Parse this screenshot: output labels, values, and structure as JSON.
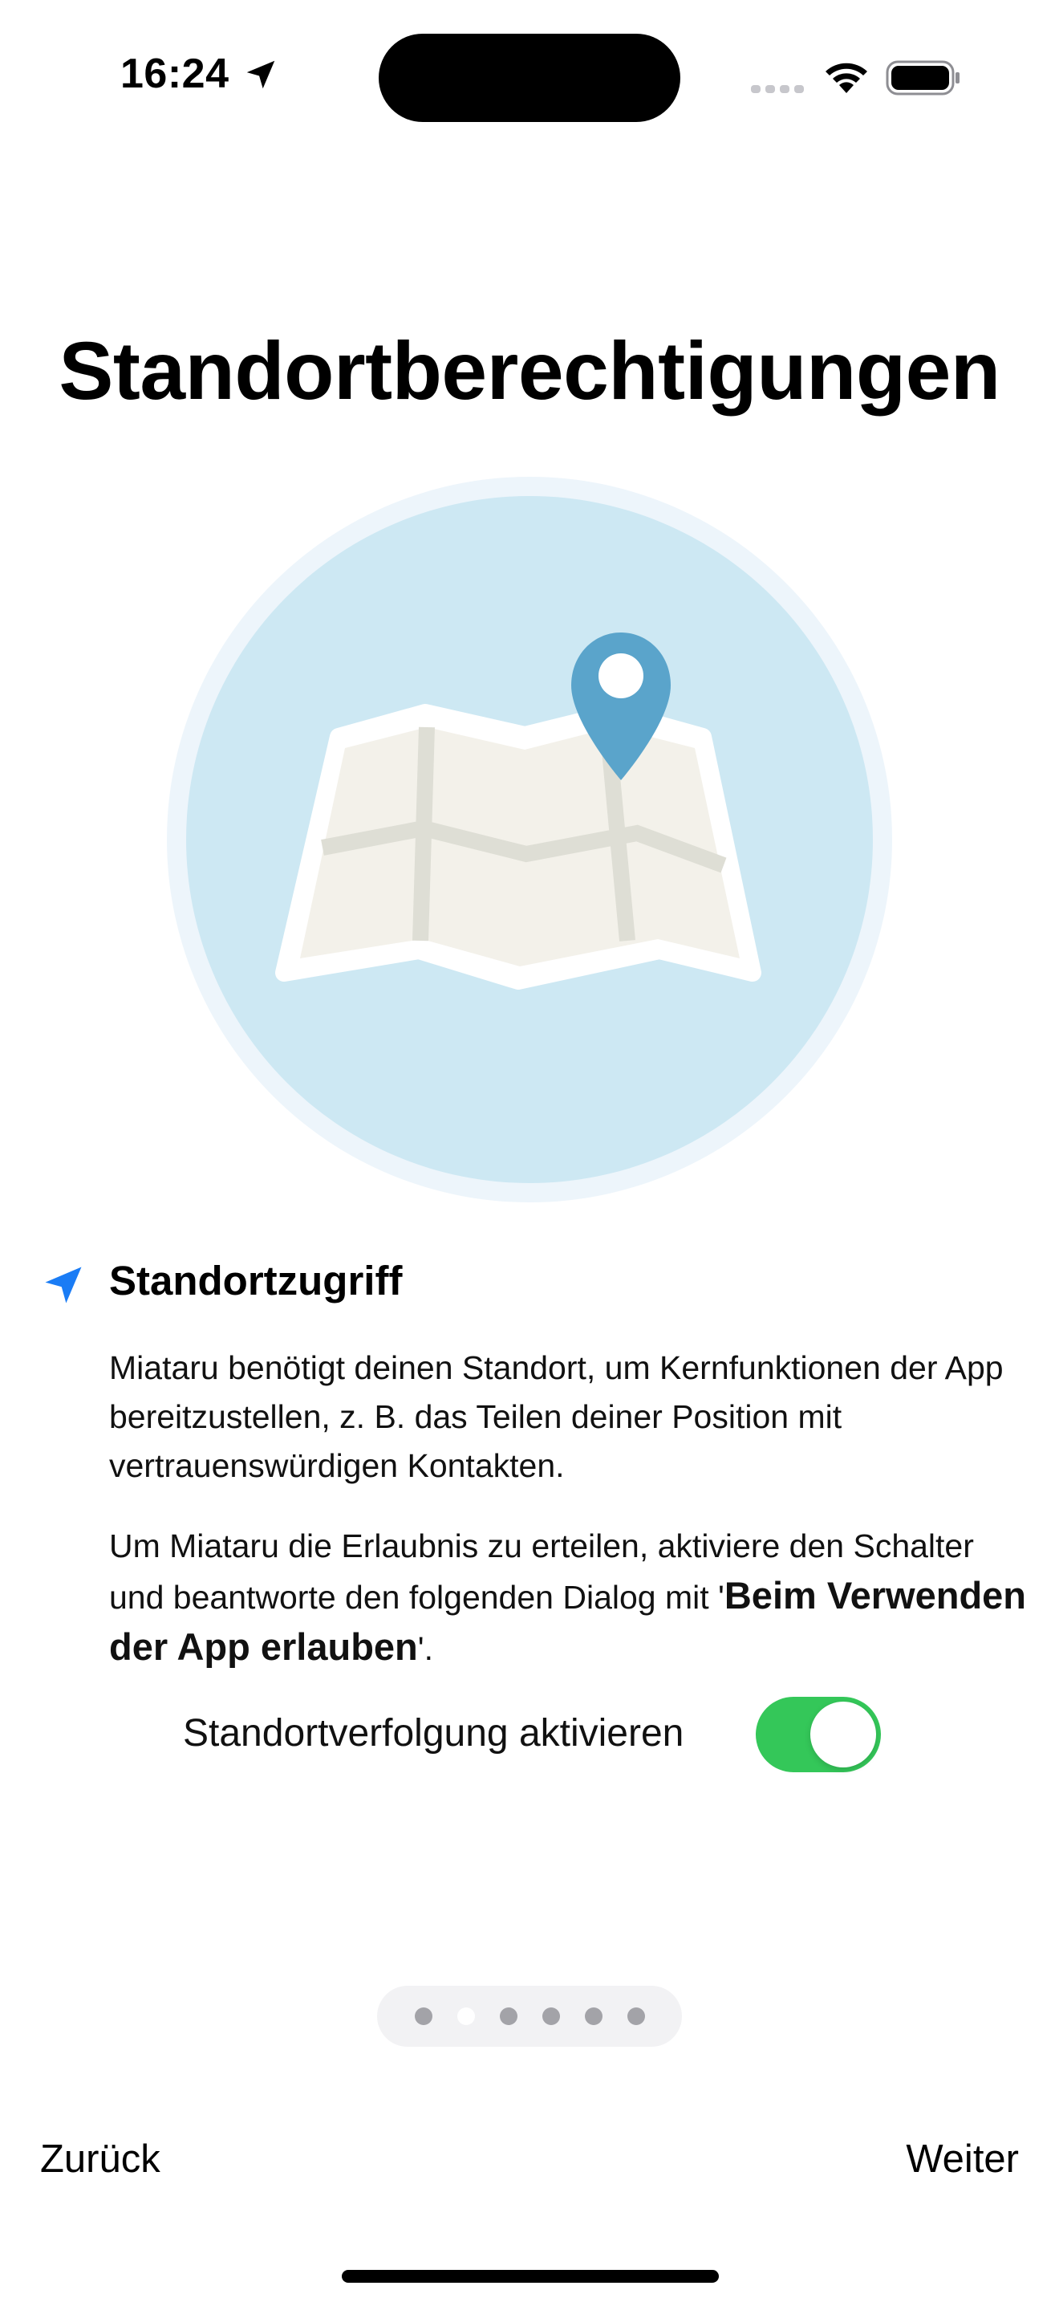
{
  "status_bar": {
    "time": "16:24",
    "icons": [
      "location-arrow-icon",
      "signal-dots-icon",
      "wifi-icon",
      "battery-icon"
    ]
  },
  "page": {
    "title": "Standortberechtigungen"
  },
  "hero": {
    "icon": "map-with-pin-icon",
    "colors": {
      "outer_ring": "#edf5fb",
      "circle": "#cde8f3",
      "map_paper": "#f3f1ea",
      "map_roads": "#deded5",
      "pin": "#5aa4cb"
    }
  },
  "feature": {
    "icon": "location-arrow-icon",
    "icon_color": "#1a7cf5",
    "title": "Standortzugriff",
    "description": "Miataru benötigt deinen Standort, um Kernfunktionen der App bereitzustellen, z. B. das Teilen deiner Position mit vertrauenswürdigen Kontakten.",
    "instructions_prefix": "Um Miataru die Erlaubnis zu erteilen, aktiviere den Schalter und beantworte den folgenden Dialog mit '",
    "instructions_highlight": "Beim Verwenden der App erlauben",
    "instructions_suffix": "'."
  },
  "toggle": {
    "label": "Standortverfolgung aktivieren",
    "is_on": true,
    "on_color": "#34c759"
  },
  "pager": {
    "total_pages": 6,
    "current_page": 2
  },
  "nav": {
    "back_label": "Zurück",
    "next_label": "Weiter"
  }
}
